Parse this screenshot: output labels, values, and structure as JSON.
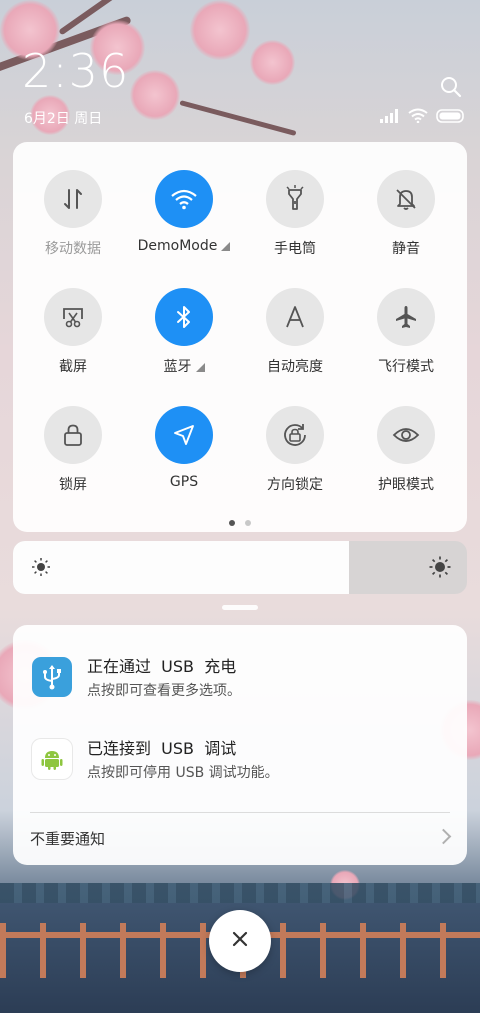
{
  "status_bar": {
    "time": "2:36",
    "date": "6月2日 周日"
  },
  "quick_settings": {
    "tiles": [
      {
        "label": "移动数据",
        "icon": "mobile-data-icon",
        "active": false,
        "disabled": true
      },
      {
        "label": "DemoMode",
        "icon": "wifi-icon",
        "active": true,
        "expandable": true
      },
      {
        "label": "手电筒",
        "icon": "flashlight-icon",
        "active": false
      },
      {
        "label": "静音",
        "icon": "mute-bell-icon",
        "active": false
      },
      {
        "label": "截屏",
        "icon": "screenshot-icon",
        "active": false
      },
      {
        "label": "蓝牙",
        "icon": "bluetooth-icon",
        "active": true,
        "expandable": true
      },
      {
        "label": "自动亮度",
        "icon": "auto-brightness-icon",
        "active": false
      },
      {
        "label": "飞行模式",
        "icon": "airplane-icon",
        "active": false
      },
      {
        "label": "锁屏",
        "icon": "lock-icon",
        "active": false
      },
      {
        "label": "GPS",
        "icon": "gps-icon",
        "active": true
      },
      {
        "label": "方向锁定",
        "icon": "rotation-lock-icon",
        "active": false
      },
      {
        "label": "护眼模式",
        "icon": "eye-icon",
        "active": false
      }
    ],
    "page_index": 1,
    "page_count": 2
  },
  "brightness": {
    "level": 0.74
  },
  "notifications": [
    {
      "title": "正在通过  USB  充电",
      "text": "点按即可查看更多选项。",
      "icon": "usb-icon"
    },
    {
      "title": "已连接到  USB  调试",
      "text": "点按即可停用 USB 调试功能。",
      "icon": "android-icon"
    }
  ],
  "minor_notifications_label": "不重要通知",
  "colors": {
    "accent": "#1e90f5",
    "tile_off": "#e6e6e6"
  }
}
